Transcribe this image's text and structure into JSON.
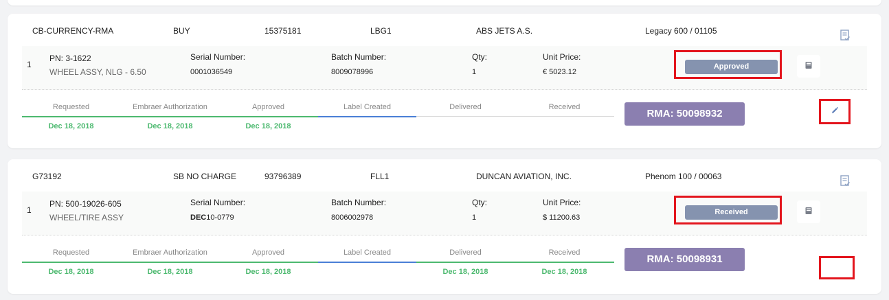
{
  "cards": [
    {
      "code": "CB-CURRENCY-RMA",
      "type": "BUY",
      "number": "15375181",
      "location": "LBG1",
      "customer": "ABS JETS A.S.",
      "aircraft": "Legacy 600 / 01105",
      "item": {
        "index": "1",
        "pn_label": "PN: 3-1622",
        "description": "WHEEL ASSY, NLG - 6.50",
        "serial_label": "Serial Number:",
        "serial_value": "0001036549",
        "batch_label": "Batch Number:",
        "batch_value": "8009078996",
        "qty_label": "Qty:",
        "qty_value": "1",
        "price_label": "Unit Price:",
        "price_value": "€ 5023.12",
        "status": "Approved"
      },
      "timeline": [
        {
          "label": "Requested",
          "date": "Dec 18, 2018"
        },
        {
          "label": "Embraer Authorization",
          "date": "Dec 18, 2018"
        },
        {
          "label": "Approved",
          "date": "Dec 18, 2018"
        },
        {
          "label": "Label Created",
          "date": ""
        },
        {
          "label": "Delivered",
          "date": ""
        },
        {
          "label": "Received",
          "date": ""
        }
      ],
      "rma": "RMA: 50098932"
    },
    {
      "code": "G73192",
      "type": "SB NO CHARGE",
      "number": "93796389",
      "location": "FLL1",
      "customer": "DUNCAN AVIATION, INC.",
      "aircraft": "Phenom 100 / 00063",
      "item": {
        "index": "1",
        "pn_label": "PN: 500-19026-605",
        "description": "WHEEL/TIRE ASSY",
        "serial_label": "Serial Number:",
        "serial_value_bold": "DEC",
        "serial_value_rest": "10-0779",
        "batch_label": "Batch Number:",
        "batch_value": "8006002978",
        "qty_label": "Qty:",
        "qty_value": "1",
        "price_label": "Unit Price:",
        "price_value": "$ 11200.63",
        "status": "Received"
      },
      "timeline": [
        {
          "label": "Requested",
          "date": "Dec 18, 2018"
        },
        {
          "label": "Embraer Authorization",
          "date": "Dec 18, 2018"
        },
        {
          "label": "Approved",
          "date": "Dec 18, 2018"
        },
        {
          "label": "Label Created",
          "date": ""
        },
        {
          "label": "Delivered",
          "date": "Dec 18, 2018"
        },
        {
          "label": "Received",
          "date": "Dec 18, 2018"
        }
      ],
      "rma": "RMA: 50098931"
    }
  ],
  "icons": {
    "document_check": "document-check-icon",
    "book": "book-icon",
    "edit": "pencil-icon"
  },
  "colors": {
    "status_badge": "#8593af",
    "rma_badge": "#8b7fb0",
    "completed": "#4cb96f",
    "current": "#4a7fd6",
    "highlight": "#e3151d"
  }
}
